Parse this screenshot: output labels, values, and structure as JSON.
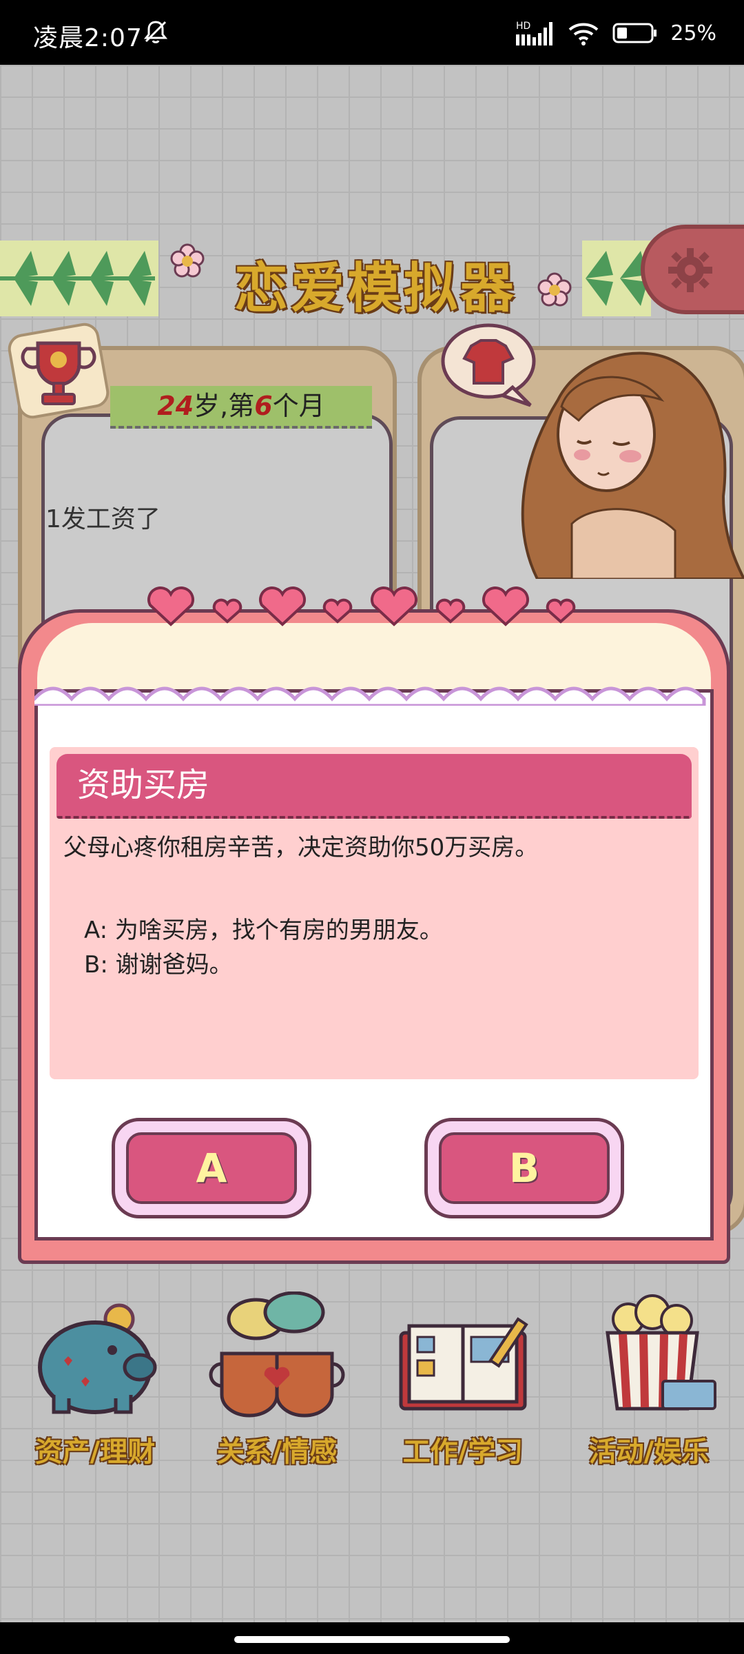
{
  "status_bar": {
    "time": "凌晨2:07",
    "network": "HD",
    "battery_percent": "25%"
  },
  "game": {
    "title": "恋爱模拟器",
    "age_label_age": "24",
    "age_label_mid": "岁,第",
    "age_label_month": "6",
    "age_label_end": "个月",
    "log_preview": "1发工资了"
  },
  "modal": {
    "event_title": "资助买房",
    "event_description": "父母心疼你租房辛苦，决定资助你50万买房。",
    "options": [
      {
        "text": "A: 为啥买房，找个有房的男朋友。"
      },
      {
        "text": "B: 谢谢爸妈。"
      }
    ],
    "button_a": "A",
    "button_b": "B"
  },
  "bottom_nav": [
    {
      "label": "资产/理财",
      "icon": "piggy-bank-icon"
    },
    {
      "label": "关系/情感",
      "icon": "coffee-cups-icon"
    },
    {
      "label": "工作/学习",
      "icon": "open-book-icon"
    },
    {
      "label": "活动/娱乐",
      "icon": "popcorn-icon"
    }
  ],
  "colors": {
    "accent": "#d9567f",
    "modal_frame": "#f2898c",
    "card": "#ffcfcf",
    "gold_text": "#d8a92c"
  }
}
